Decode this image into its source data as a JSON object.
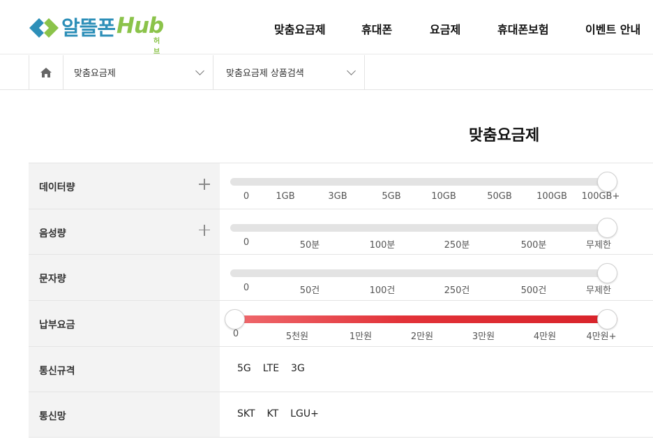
{
  "header": {
    "logo_text": "알뜰폰",
    "logo_hub": "Hub",
    "logo_sub": "허브",
    "nav": [
      "맞춤요금제",
      "휴대폰",
      "요금제",
      "휴대폰보험",
      "이벤트 안내"
    ]
  },
  "breadcrumb": {
    "home_icon": "home-icon",
    "level1": "맞춤요금제",
    "level2": "맞춤요금제 상품검색"
  },
  "page_title": "맞춤요금제",
  "filters": [
    {
      "label": "데이터량",
      "expandable": true,
      "type": "slider",
      "ticks": [
        "0",
        "1GB",
        "3GB",
        "5GB",
        "10GB",
        "50GB",
        "100GB",
        "100GB+"
      ],
      "selected_range": [
        "100GB+",
        "100GB+"
      ]
    },
    {
      "label": "음성량",
      "expandable": true,
      "type": "slider",
      "ticks": [
        "0",
        "50분",
        "100분",
        "250분",
        "500분",
        "무제한"
      ],
      "selected_range": [
        "무제한",
        "무제한"
      ]
    },
    {
      "label": "문자량",
      "expandable": false,
      "type": "slider",
      "ticks": [
        "0",
        "50건",
        "100건",
        "250건",
        "500건",
        "무제한"
      ],
      "selected_range": [
        "무제한",
        "무제한"
      ]
    },
    {
      "label": "납부요금",
      "expandable": false,
      "type": "range",
      "ticks": [
        "0",
        "5천원",
        "1만원",
        "2만원",
        "3만원",
        "4만원",
        "4만원+"
      ],
      "selected_range": [
        "0",
        "4만원+"
      ],
      "fill_color": "#dd2a30"
    },
    {
      "label": "통신규격",
      "expandable": false,
      "type": "options",
      "options": [
        "5G",
        "LTE",
        "3G"
      ]
    },
    {
      "label": "통신망",
      "expandable": false,
      "type": "options",
      "options": [
        "SKT",
        "KT",
        "LGU+"
      ]
    }
  ],
  "colors": {
    "brand_blue": "#2d8fb8",
    "brand_green": "#8bc34a",
    "accent_red": "#dd2a30"
  }
}
